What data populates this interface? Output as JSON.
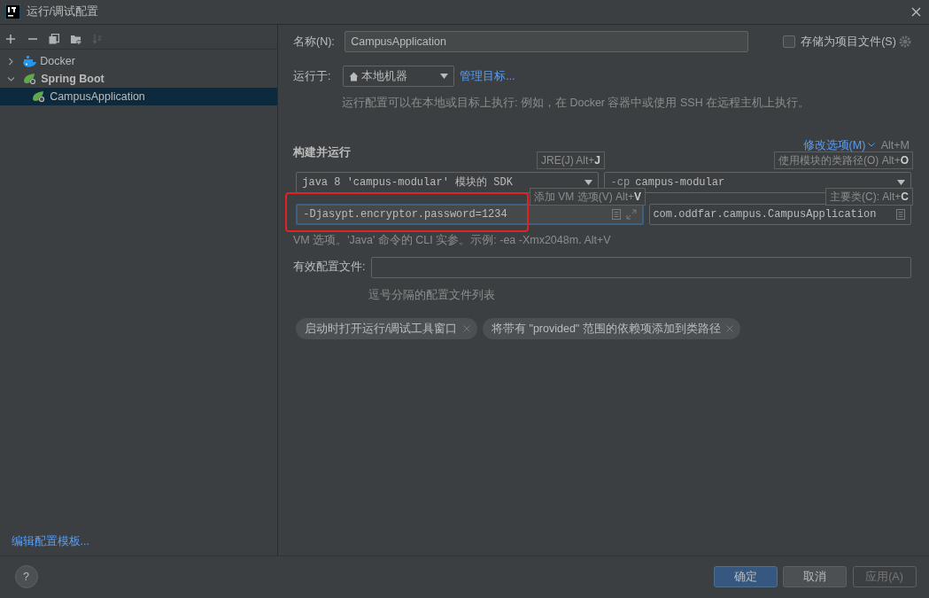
{
  "window": {
    "title": "运行/调试配置"
  },
  "toolbar": [
    {
      "disabled": false
    },
    {
      "disabled": false
    },
    {
      "disabled": false
    },
    {
      "disabled": false
    },
    {
      "disabled": true
    }
  ],
  "tree": [
    {
      "label": "Docker",
      "kind": "docker",
      "expanded": false,
      "selected": false
    },
    {
      "label": "Spring Boot",
      "kind": "spring",
      "expanded": true,
      "selected": false,
      "children": [
        {
          "label": "CampusApplication",
          "kind": "spring",
          "selected": true
        }
      ]
    }
  ],
  "sidebar_link": "编辑配置模板...",
  "form": {
    "name_label": "名称(N):",
    "name_value": "CampusApplication",
    "store_checkbox": {
      "label": "存储为项目文件(S)",
      "checked": false
    },
    "run_on_label": "运行于:",
    "run_on_value": "本地机器",
    "manage_link": "管理目标...",
    "run_on_hint": "运行配置可以在本地或目标上执行: 例如，在 Docker 容器中或使用 SSH 在远程主机上执行。"
  },
  "build": {
    "heading": "构建并运行",
    "modify_link": "修改选项(M)",
    "modify_shortcut": "Alt+M",
    "jre": "java 8 'campus-modular' 模块的 SDK",
    "cp_prefix": "-cp",
    "cp_value": "campus-modular",
    "vm_options": {
      "value": "-Djasypt.encryptor.password=1234",
      "highlighted": true
    },
    "main_class": "com.oddfar.campus.CampusApplication",
    "vm_hint": "VM 选项。'Java' 命令的 CLI 实参。示例: -ea -Xmx2048m. Alt+V",
    "tooltips": [
      "JRE(J) Alt+**J**",
      "使用模块的类路径(O) Alt+**O**",
      "添加 VM 选项(V) Alt+**V**",
      "主要类(C): Alt+**C**"
    ]
  },
  "profiles": {
    "label": "有效配置文件:",
    "hint": "逗号分隔的配置文件列表"
  },
  "tags": [
    {
      "label": "启动时打开运行/调试工具窗口"
    },
    {
      "label": "将带有 \"provided\" 范围的依赖项添加到类路径"
    }
  ],
  "footer": {
    "help": "?",
    "buttons": [
      {
        "label": "确定",
        "primary": true,
        "disabled": false
      },
      {
        "label": "取消",
        "primary": false,
        "disabled": false
      },
      {
        "label": "应用(A)",
        "primary": false,
        "disabled": true
      }
    ]
  }
}
